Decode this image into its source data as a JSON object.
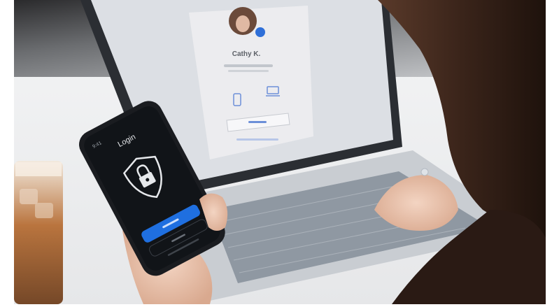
{
  "laptop": {
    "profile_name": "Cathy K.",
    "profile_subtitle": "",
    "primary_button": "",
    "footer_link": ""
  },
  "phone": {
    "status_time": "9:41",
    "title": "Login",
    "primary_button": "",
    "secondary_button": "",
    "footer_text": ""
  },
  "colors": {
    "accent_blue": "#1f6fe0",
    "phone_screen": "#111418",
    "laptop_screen": "#dcdfe4",
    "keyboard": "#9aa2ab",
    "hair": "#3a241a"
  }
}
